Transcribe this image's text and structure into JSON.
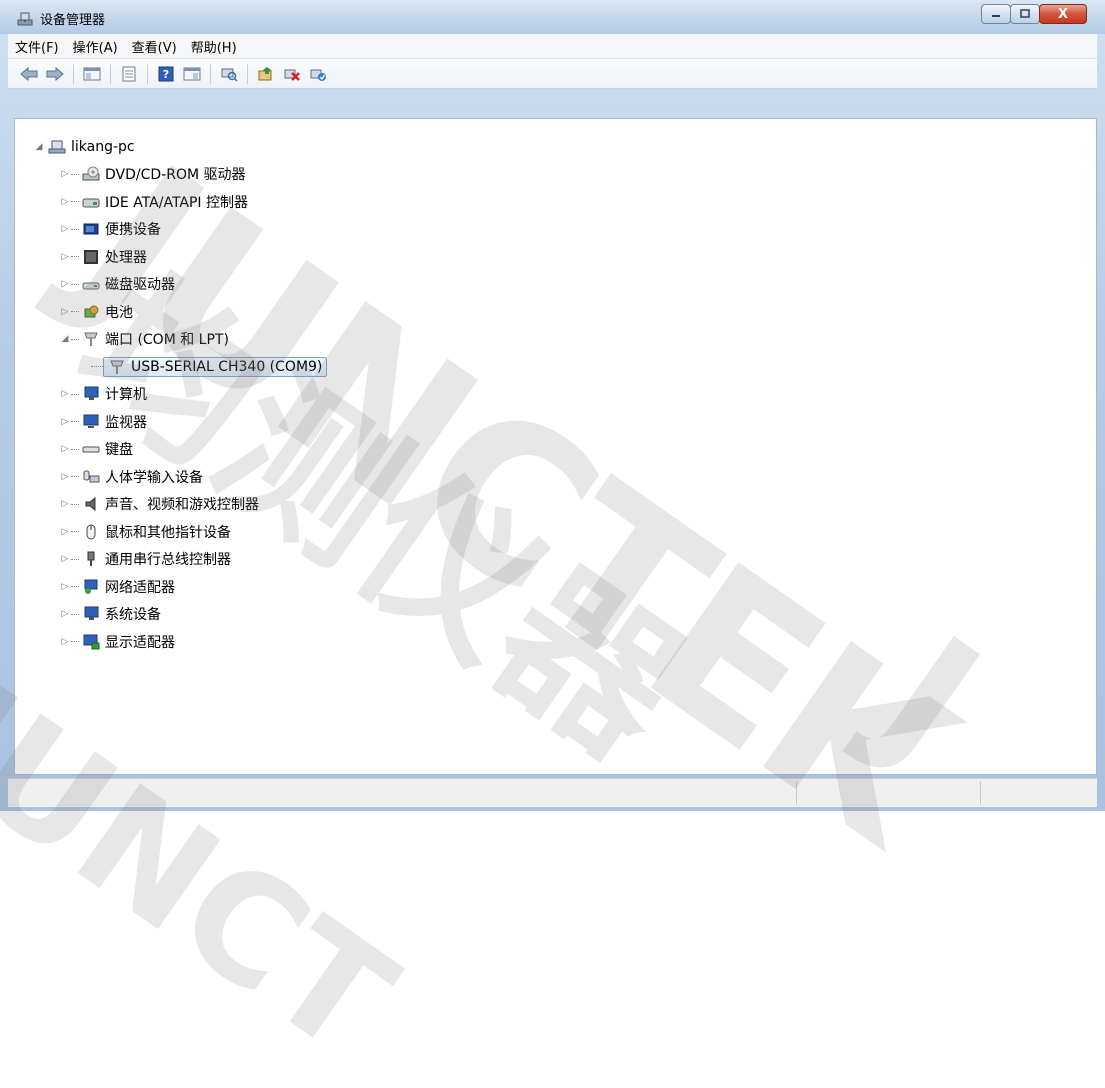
{
  "window": {
    "title": "设备管理器",
    "controls": {
      "minimize_icon": "minimize-icon",
      "maximize_icon": "maximize-icon",
      "close_icon": "close-icon",
      "close_glyph": "X"
    }
  },
  "menu": [
    {
      "label": "文件(F)"
    },
    {
      "label": "操作(A)"
    },
    {
      "label": "查看(V)"
    },
    {
      "label": "帮助(H)"
    }
  ],
  "toolbar": [
    "back-icon",
    "forward-icon",
    "sep",
    "show-hide-tree-icon",
    "sep",
    "properties-icon",
    "sep",
    "help-icon",
    "view-icon",
    "sep",
    "scan-hardware-icon",
    "sep",
    "update-driver-icon",
    "uninstall-icon",
    "enable-icon"
  ],
  "tree": {
    "root": {
      "label": "likang-pc",
      "icon": "computer-icon",
      "expanded": true
    },
    "items": [
      {
        "label": "DVD/CD-ROM 驱动器",
        "icon": "dvd-drive-icon"
      },
      {
        "label": "IDE ATA/ATAPI 控制器",
        "icon": "ide-controller-icon"
      },
      {
        "label": "便携设备",
        "icon": "portable-device-icon"
      },
      {
        "label": "处理器",
        "icon": "processor-icon"
      },
      {
        "label": "磁盘驱动器",
        "icon": "disk-drive-icon"
      },
      {
        "label": "电池",
        "icon": "battery-icon"
      },
      {
        "label": "端口 (COM 和 LPT)",
        "icon": "port-icon",
        "expanded": true,
        "children": [
          {
            "label": "USB-SERIAL CH340 (COM9)",
            "icon": "port-icon",
            "selected": true
          }
        ]
      },
      {
        "label": "计算机",
        "icon": "computer-small-icon"
      },
      {
        "label": "监视器",
        "icon": "monitor-icon"
      },
      {
        "label": "键盘",
        "icon": "keyboard-icon"
      },
      {
        "label": "人体学输入设备",
        "icon": "hid-icon"
      },
      {
        "label": "声音、视频和游戏控制器",
        "icon": "speaker-icon"
      },
      {
        "label": "鼠标和其他指针设备",
        "icon": "mouse-icon"
      },
      {
        "label": "通用串行总线控制器",
        "icon": "usb-icon"
      },
      {
        "label": "网络适配器",
        "icon": "network-adapter-icon"
      },
      {
        "label": "系统设备",
        "icon": "system-device-icon"
      },
      {
        "label": "显示适配器",
        "icon": "display-adapter-icon"
      }
    ]
  },
  "watermark": {
    "latin": "JUNCTEK",
    "cjk": "均测仪器",
    "tail_a": "JUNCT",
    "tail_b": "J"
  }
}
